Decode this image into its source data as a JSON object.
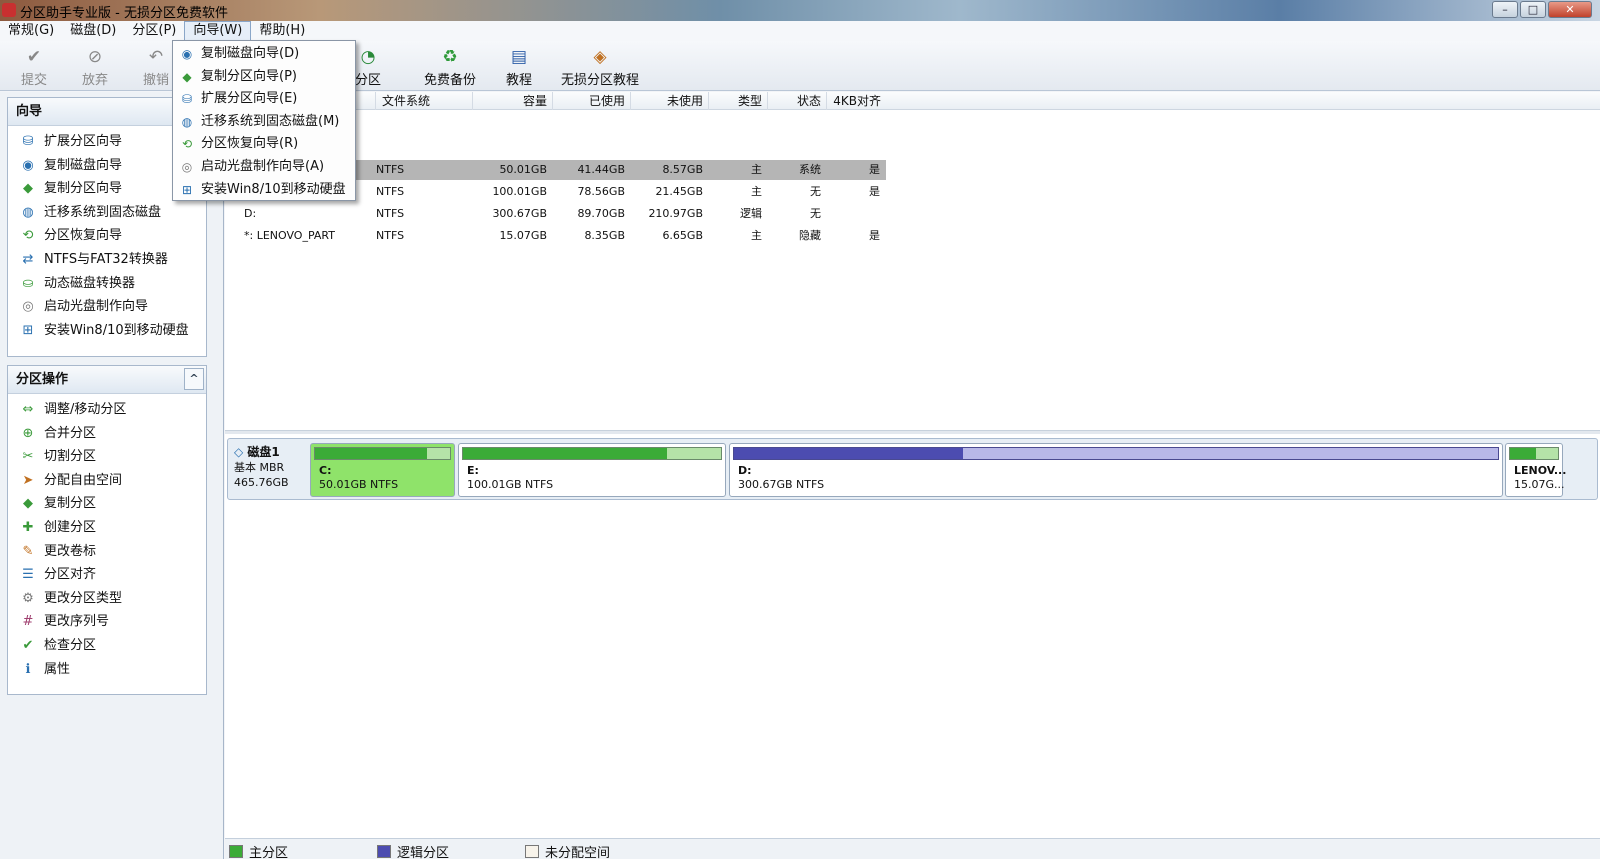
{
  "window": {
    "title": "分区助手专业版 - 无损分区免费软件",
    "buttons": {
      "minimize": "–",
      "maximize": "□",
      "close": "✕"
    }
  },
  "menubar": [
    {
      "label": "常规(G)"
    },
    {
      "label": "磁盘(D)"
    },
    {
      "label": "分区(P)"
    },
    {
      "label": "向导(W)"
    },
    {
      "label": "帮助(H)"
    }
  ],
  "toolbar": {
    "submit": "提交",
    "discard": "放弃",
    "undo": "撤销",
    "partition": "分区",
    "backup": "免费备份",
    "tutorial": "教程",
    "lossless_tutorial": "无损分区教程"
  },
  "wizard_panel": {
    "title": "向导",
    "items": [
      {
        "label": "扩展分区向导",
        "icon": "drive-icon"
      },
      {
        "label": "复制磁盘向导",
        "icon": "disk-copy-icon"
      },
      {
        "label": "复制分区向导",
        "icon": "partition-copy-icon"
      },
      {
        "label": "迁移系统到固态磁盘",
        "icon": "ssd-icon"
      },
      {
        "label": "分区恢复向导",
        "icon": "recover-icon"
      },
      {
        "label": "NTFS与FAT32转换器",
        "icon": "convert-icon"
      },
      {
        "label": "动态磁盘转换器",
        "icon": "dynamic-disk-icon"
      },
      {
        "label": "启动光盘制作向导",
        "icon": "cd-icon"
      },
      {
        "label": "安装Win8/10到移动硬盘",
        "icon": "windows-icon"
      }
    ]
  },
  "partition_ops_panel": {
    "title": "分区操作",
    "collapse": "^",
    "items": [
      {
        "label": "调整/移动分区"
      },
      {
        "label": "合并分区"
      },
      {
        "label": "切割分区"
      },
      {
        "label": "分配自由空间"
      },
      {
        "label": "复制分区"
      },
      {
        "label": "创建分区"
      },
      {
        "label": "更改卷标"
      },
      {
        "label": "分区对齐"
      },
      {
        "label": "更改分区类型"
      },
      {
        "label": "更改序列号"
      },
      {
        "label": "检查分区"
      },
      {
        "label": "属性"
      }
    ]
  },
  "table": {
    "columns": [
      "文件系统",
      "容量",
      "已使用",
      "未使用",
      "类型",
      "状态",
      "4KB对齐"
    ],
    "rows": [
      {
        "name": "",
        "fs": "NTFS",
        "capacity": "50.01GB",
        "used": "41.44GB",
        "free": "8.57GB",
        "type": "主",
        "status": "系统",
        "align": "是"
      },
      {
        "name": "",
        "fs": "NTFS",
        "capacity": "100.01GB",
        "used": "78.56GB",
        "free": "21.45GB",
        "type": "主",
        "status": "无",
        "align": "是"
      },
      {
        "name": "D:",
        "fs": "NTFS",
        "capacity": "300.67GB",
        "used": "89.70GB",
        "free": "210.97GB",
        "type": "逻辑",
        "status": "无",
        "align": ""
      },
      {
        "name": "*: LENOVO_PART",
        "fs": "NTFS",
        "capacity": "15.07GB",
        "used": "8.35GB",
        "free": "6.65GB",
        "type": "主",
        "status": "隐藏",
        "align": "是"
      }
    ]
  },
  "disk_map": {
    "disk_name": "磁盘1",
    "disk_type": "基本 MBR",
    "disk_size": "465.76GB",
    "partitions": [
      {
        "name": "C:",
        "size": "50.01GB NTFS",
        "used_fraction": 0.83,
        "kind": "primary",
        "selected": true
      },
      {
        "name": "E:",
        "size": "100.01GB NTFS",
        "used_fraction": 0.79,
        "kind": "primary",
        "selected": false
      },
      {
        "name": "D:",
        "size": "300.67GB NTFS",
        "used_fraction": 0.3,
        "kind": "logical",
        "selected": false
      },
      {
        "name": "LENOV...",
        "size": "15.07G...",
        "used_fraction": 0.55,
        "kind": "primary",
        "selected": false
      }
    ]
  },
  "legend": {
    "primary": "主分区",
    "logical": "逻辑分区",
    "unallocated": "未分配空间"
  },
  "wizard_menu": {
    "items": [
      {
        "label": "复制磁盘向导(D)"
      },
      {
        "label": "复制分区向导(P)"
      },
      {
        "label": "扩展分区向导(E)"
      },
      {
        "label": "迁移系统到固态磁盘(M)"
      },
      {
        "label": "分区恢复向导(R)"
      },
      {
        "label": "启动光盘制作向导(A)"
      },
      {
        "label": "安装Win8/10到移动硬盘"
      }
    ]
  },
  "colors": {
    "primary": "#3bab37",
    "primary_light": "#b5e3a8",
    "logical": "#4c4cb0",
    "logical_light": "#b8b8e8",
    "selected_partition": "#8fe36a",
    "selected_row": "#b5b5b5"
  }
}
